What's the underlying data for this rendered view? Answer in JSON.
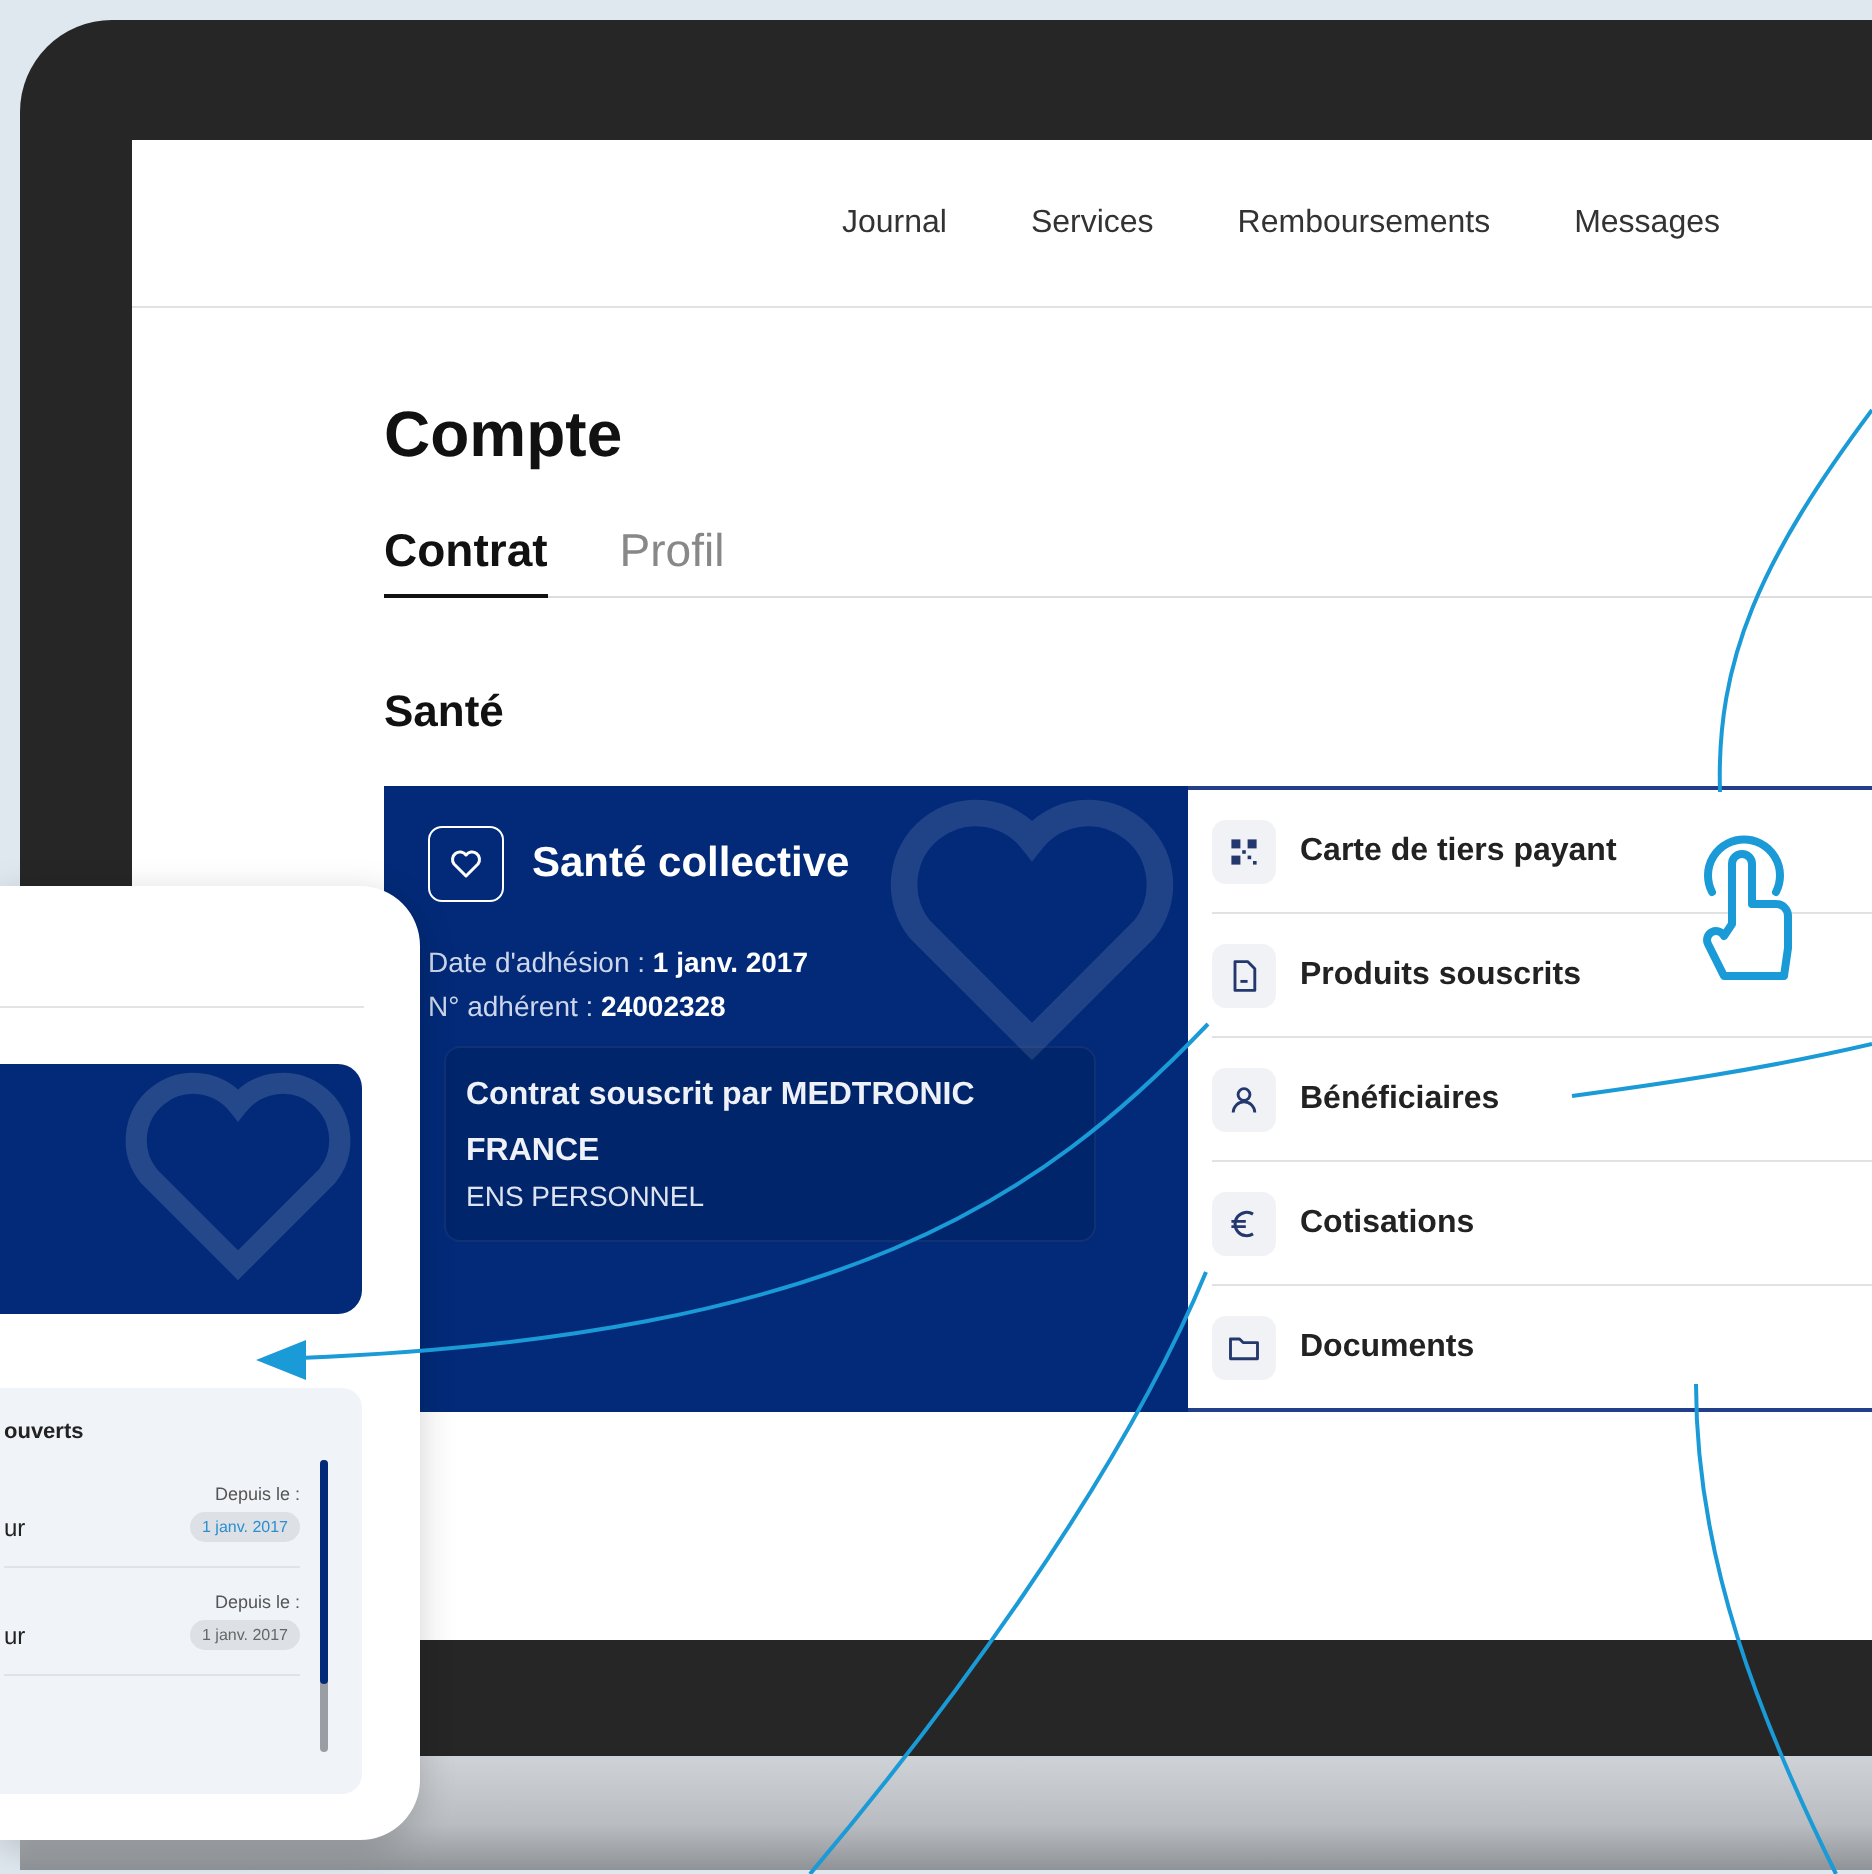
{
  "nav": {
    "links": [
      {
        "label": "Journal"
      },
      {
        "label": "Services"
      },
      {
        "label": "Remboursements"
      },
      {
        "label": "Messages"
      }
    ]
  },
  "page": {
    "title": "Compte",
    "tabs": [
      {
        "label": "Contrat",
        "selected": true
      },
      {
        "label": "Profil",
        "selected": false
      }
    ],
    "section": "Santé"
  },
  "contract_card": {
    "title": "Santé collective",
    "details": [
      "Date d'adhésion : **1 janv. 2017**",
      "N° adhérent : **24002328**"
    ],
    "subscriber": "Contrat souscrit par MEDTRONIC FRANCE",
    "group": "ENS PERSONNEL"
  },
  "menu": [
    {
      "label": "Carte de tiers payant",
      "kind": "qr"
    },
    {
      "label": "Produits souscrits",
      "kind": "document"
    },
    {
      "label": "Bénéficiaires",
      "kind": "person"
    },
    {
      "label": "Cotisations",
      "kind": "euro"
    },
    {
      "label": "Documents",
      "kind": "folder"
    }
  ],
  "phone": {
    "section_title": "ouverts",
    "rows": [
      {
        "label": "ur",
        "since_label": "Depuis le :",
        "date": "1 janv. 2017",
        "highlighted": true
      },
      {
        "label": "ur",
        "since_label": "Depuis le :",
        "date": "1 janv. 2017",
        "highlighted": false
      }
    ]
  }
}
